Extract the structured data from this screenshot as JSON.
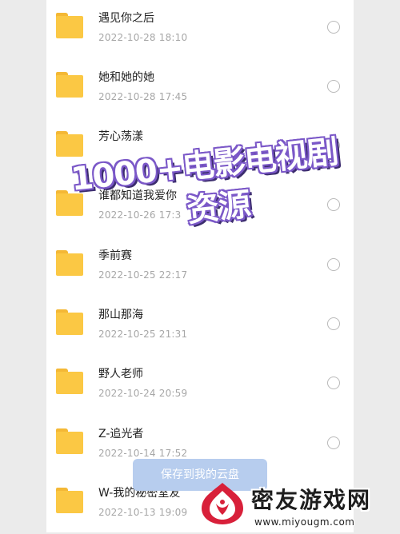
{
  "files": [
    {
      "name": "遇见你之后",
      "date": "2022-10-28 18:10"
    },
    {
      "name": "她和她的她",
      "date": "2022-10-28 17:45"
    },
    {
      "name": "芳心荡漾",
      "date": ""
    },
    {
      "name": "谁都知道我爱你",
      "date": "2022-10-26 17:3"
    },
    {
      "name": "季前赛",
      "date": "2022-10-25 22:17"
    },
    {
      "name": "那山那海",
      "date": "2022-10-25 21:31"
    },
    {
      "name": "野人老师",
      "date": "2022-10-24 20:59"
    },
    {
      "name": "Z-追光者",
      "date": "2022-10-14 17:52"
    },
    {
      "name": "W-我的秘密室友",
      "date": "2022-10-13 19:09"
    }
  ],
  "save_button": {
    "label": "保存到我的云盘"
  },
  "promo": {
    "line1": "1000+电影电视剧",
    "line2": "资源"
  },
  "watermark": {
    "title": "密友游戏网",
    "url": "www.miyougm.com"
  },
  "colors": {
    "folder": "#fbc844",
    "button": "#b7cdee",
    "promo_outline": "#7b58c8",
    "date_text": "#a7a7a7"
  },
  "icons": {
    "folder": "folder-icon",
    "radio": "radio-button-icon",
    "logo": "miyou-logo-icon"
  }
}
